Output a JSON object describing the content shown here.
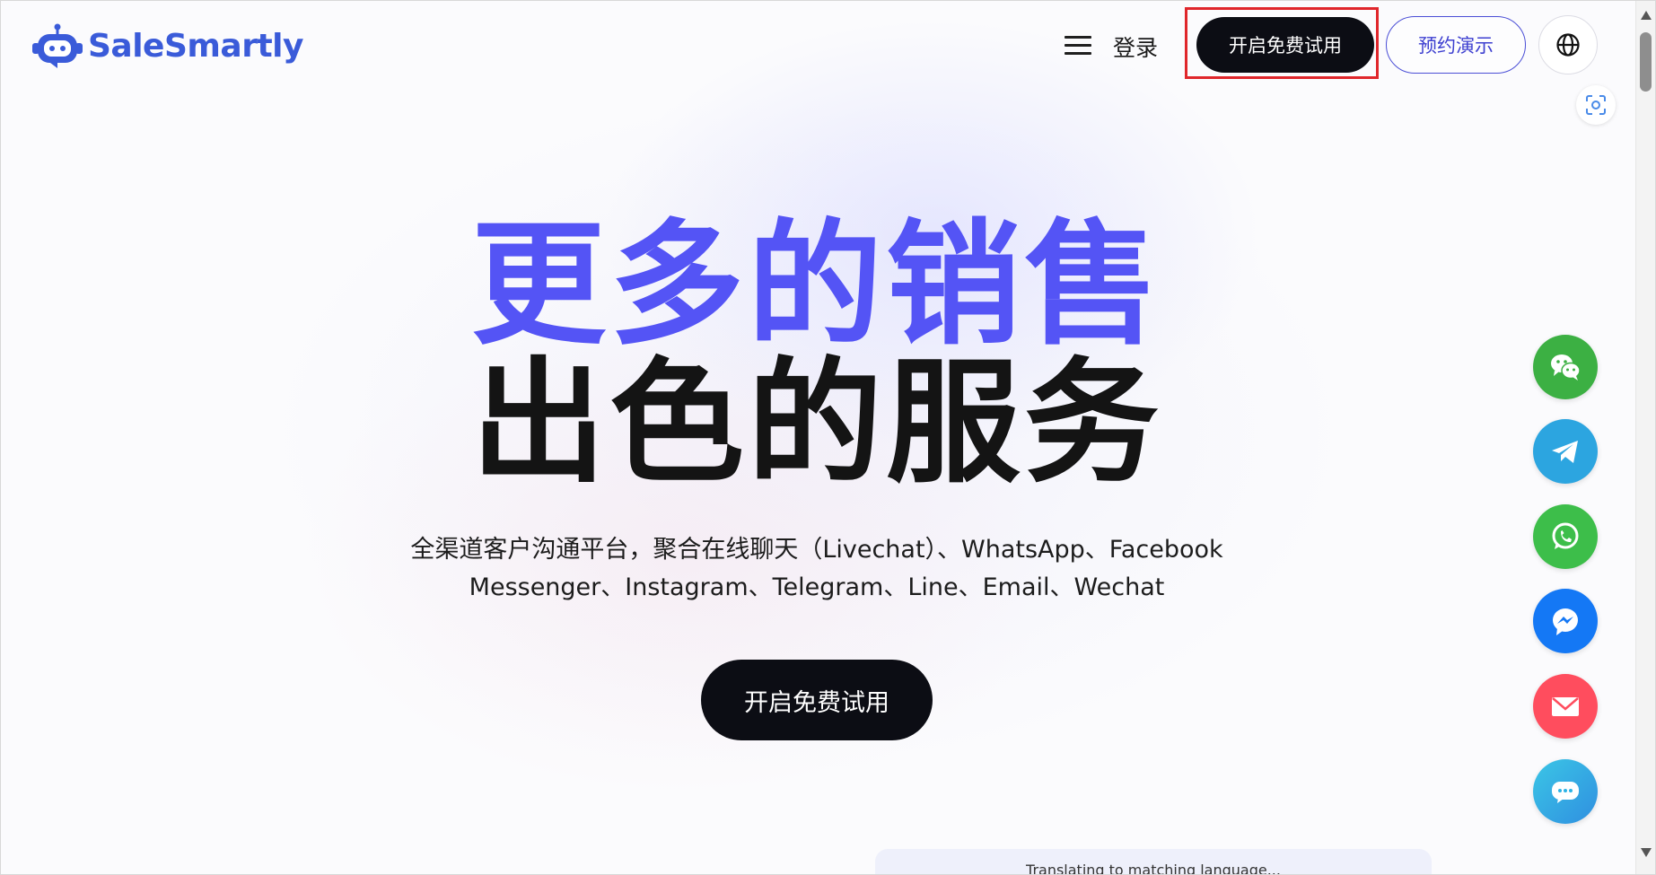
{
  "header": {
    "logo_text": "SaleSmartly",
    "brand_color": "#3a5bd9",
    "login_label": "登录",
    "trial_button_label": "开启免费试用",
    "demo_button_label": "预约演示",
    "menu_icon": "hamburger-menu-icon",
    "language_icon": "globe-icon",
    "highlight_color": "#e0262b"
  },
  "hero": {
    "headline_line1": "更多的销售",
    "headline_line2": "出色的服务",
    "headline_accent_color": "#5454f5",
    "subtitle_line1": "全渠道客户沟通平台，聚合在线聊天（Livechat）、WhatsApp、Facebook",
    "subtitle_line2": "Messenger、Instagram、Telegram、Line、Email、Wechat",
    "cta_label": "开启免费试用"
  },
  "floating_contacts": [
    {
      "name": "wechat-icon",
      "color": "#3cb043"
    },
    {
      "name": "telegram-icon",
      "color": "#2ca5e0"
    },
    {
      "name": "whatsapp-icon",
      "color": "#3dbe4a"
    },
    {
      "name": "messenger-icon",
      "color": "#1478f5"
    },
    {
      "name": "email-icon",
      "color": "#ff4d5e"
    },
    {
      "name": "chat-icon",
      "color": "#2bb3e6"
    }
  ],
  "translate_bar": {
    "text": "Translating to matching language..."
  }
}
